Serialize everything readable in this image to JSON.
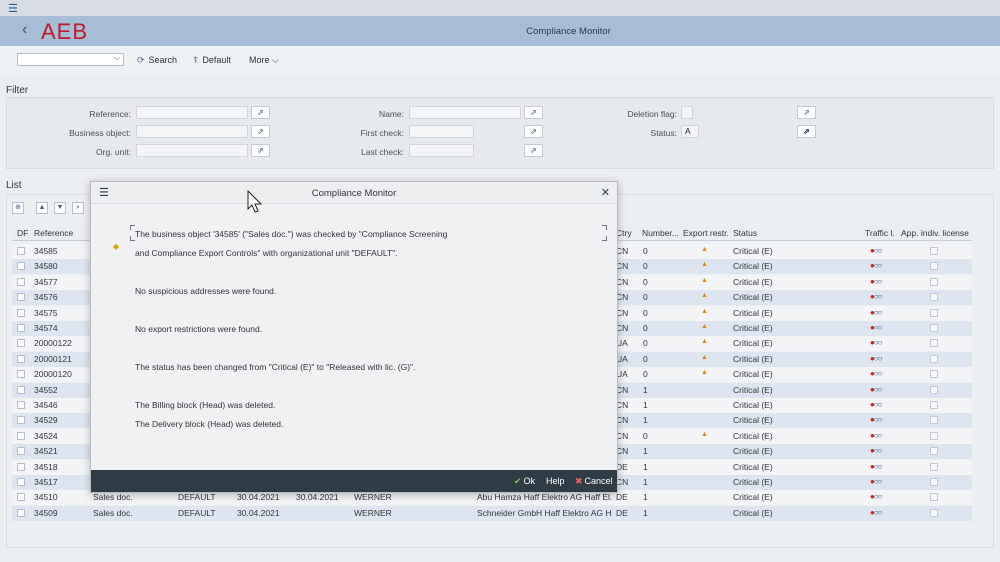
{
  "topbar": {
    "menu_icon": "hamburger-icon"
  },
  "header": {
    "logo": "AEB",
    "title": "Compliance Monitor"
  },
  "toolbar": {
    "search_label": "Search",
    "default_label": "Default",
    "more_label": "More"
  },
  "filter": {
    "section_title": "Filter",
    "reference_label": "Reference:",
    "business_object_label": "Business object:",
    "org_unit_label": "Org. unit:",
    "name_label": "Name:",
    "first_check_label": "First check:",
    "last_check_label": "Last check:",
    "deletion_flag_label": "Deletion flag:",
    "status_label": "Status:",
    "status_value": "A"
  },
  "list": {
    "section_title": "List",
    "columns": {
      "df": "DF",
      "reference": "Reference",
      "ctry": "Ctry",
      "number": "Number...",
      "export_restr": "Export restr.",
      "status": "Status",
      "traffic": "Traffic l.",
      "license": "App. indiv. license"
    },
    "rows": [
      {
        "ref": "34585",
        "ctry": "CN",
        "num": "0",
        "warn": "▲",
        "status": "Critical (E)",
        "light": "●○○"
      },
      {
        "ref": "34580",
        "ctry": "CN",
        "num": "0",
        "warn": "▲",
        "status": "Critical (E)",
        "light": "●○○"
      },
      {
        "ref": "34577",
        "ctry": "CN",
        "num": "0",
        "warn": "▲",
        "status": "Critical (E)",
        "light": "●○○"
      },
      {
        "ref": "34576",
        "ctry": "CN",
        "num": "0",
        "warn": "▲",
        "status": "Critical (E)",
        "light": "●○○"
      },
      {
        "ref": "34575",
        "ctry": "CN",
        "num": "0",
        "warn": "▲",
        "status": "Critical (E)",
        "light": "●○○"
      },
      {
        "ref": "34574",
        "ctry": "CN",
        "num": "0",
        "warn": "▲",
        "status": "Critical (E)",
        "light": "●○○"
      },
      {
        "ref": "20000122",
        "ctry": "UA",
        "num": "0",
        "warn": "▲",
        "status": "Critical (E)",
        "light": "●○○"
      },
      {
        "ref": "20000121",
        "ctry": "UA",
        "num": "0",
        "warn": "▲",
        "status": "Critical (E)",
        "light": "●○○"
      },
      {
        "ref": "20000120",
        "ctry": "UA",
        "num": "0",
        "warn": "▲",
        "status": "Critical (E)",
        "light": "●○○"
      },
      {
        "ref": "34552",
        "ctry": "CN",
        "num": "1",
        "warn": "",
        "status": "Critical (E)",
        "light": "●○○"
      },
      {
        "ref": "34546",
        "ctry": "CN",
        "num": "1",
        "warn": "",
        "status": "Critical (E)",
        "light": "●○○"
      },
      {
        "ref": "34529",
        "ctry": "CN",
        "num": "1",
        "warn": "",
        "status": "Critical (E)",
        "light": "●○○"
      },
      {
        "ref": "34524",
        "ctry": "CN",
        "num": "0",
        "warn": "▲",
        "status": "Critical (E)",
        "light": "●○○"
      },
      {
        "ref": "34521",
        "ctry": "CN",
        "num": "1",
        "warn": "",
        "status": "Critical (E)",
        "light": "●○○"
      },
      {
        "ref": "34518",
        "ctry": "DE",
        "num": "1",
        "warn": "",
        "status": "Critical (E)",
        "light": "●○○"
      },
      {
        "ref": "34517",
        "ctry": "CN",
        "num": "1",
        "warn": "",
        "status": "Critical (E)",
        "light": "●○○"
      },
      {
        "ref": "34510",
        "bo": "Sales doc.",
        "org": "DEFAULT",
        "first": "30.04.2021",
        "last": "30.04.2021",
        "user": "WERNER",
        "name": "Abu Hamza Haff Elektro AG Haff El...",
        "ctry": "DE",
        "num": "1",
        "warn": "",
        "status": "Critical (E)",
        "light": "●○○"
      },
      {
        "ref": "34509",
        "bo": "Sales doc.",
        "org": "DEFAULT",
        "first": "30.04.2021",
        "last": "",
        "user": "WERNER",
        "name": "Schneider GmbH Haff Elektro AG H...",
        "ctry": "DE",
        "num": "1",
        "warn": "",
        "status": "Critical (E)",
        "light": "●○○"
      }
    ]
  },
  "dialog": {
    "title": "Compliance Monitor",
    "messages": [
      "The business object '34585' (\"Sales doc.\") was checked by \"Compliance Screening",
      "and Compliance Export Controls\" with organizational unit \"DEFAULT\".",
      "No suspicious addresses were found.",
      "No export restrictions were found.",
      "The status has been changed from \"Critical (E)\" to \"Released with lic. (G)\".",
      "The Billing block (Head) was deleted.",
      "The Delivery block (Head) was deleted."
    ],
    "ok_label": "Ok",
    "help_label": "Help",
    "cancel_label": "Cancel"
  }
}
